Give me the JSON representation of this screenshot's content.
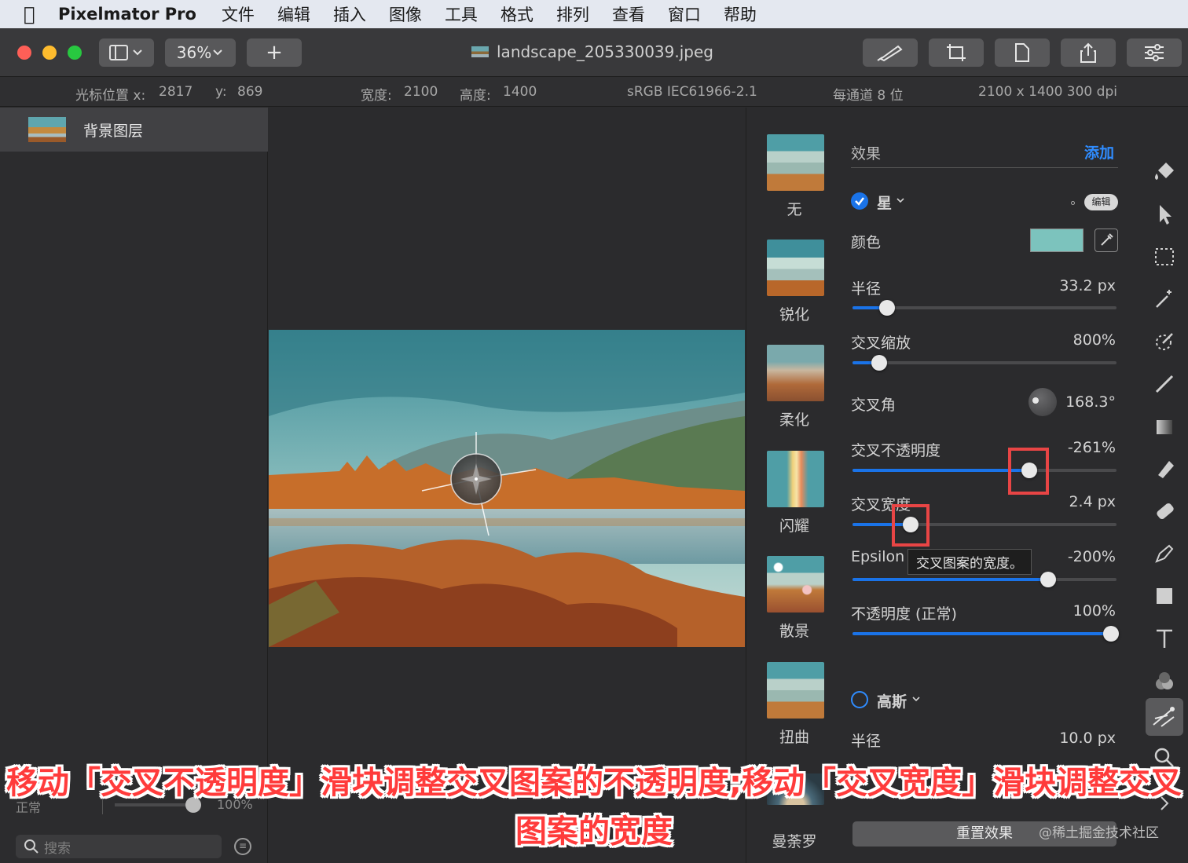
{
  "menubar": {
    "app_name": "Pixelmator Pro",
    "items": [
      "文件",
      "编辑",
      "插入",
      "图像",
      "工具",
      "格式",
      "排列",
      "查看",
      "窗口",
      "帮助"
    ]
  },
  "toolbar": {
    "zoom": "36%",
    "add_label": "+",
    "document_title": "landscape_205330039.jpeg"
  },
  "infobar": {
    "cursor_x_label": "光标位置 x:",
    "cursor_x": "2817",
    "cursor_y_label": "y:",
    "cursor_y": "869",
    "width_label": "宽度:",
    "width": "2100",
    "height_label": "高度:",
    "height": "1400",
    "color_profile": "sRGB IEC61966-2.1",
    "bit_depth": "每通道 8 位",
    "dimensions": "2100 x 1400 300 dpi"
  },
  "layers": {
    "items": [
      {
        "label": "背景图层"
      }
    ],
    "blend_mode": "正常",
    "opacity": "100%",
    "search_placeholder": "搜索"
  },
  "effect_categories": [
    {
      "label": "无"
    },
    {
      "label": "锐化"
    },
    {
      "label": "柔化"
    },
    {
      "label": "闪耀"
    },
    {
      "label": "散景"
    },
    {
      "label": "扭曲"
    },
    {
      "label": "曼荼罗"
    }
  ],
  "effects": {
    "header": "效果",
    "add_label": "添加",
    "star": {
      "name": "星",
      "enabled": true,
      "edit_label": "编辑",
      "color_label": "颜色",
      "color_swatch": "#7cc3bd",
      "params": [
        {
          "label": "半径",
          "value": "33.2 px",
          "fraction": 0.13
        },
        {
          "label": "交叉缩放",
          "value": "800%",
          "fraction": 0.1
        },
        {
          "label": "交叉角",
          "value": "168.3°"
        },
        {
          "label": "交叉不透明度",
          "value": "-261%",
          "fraction": 0.67
        },
        {
          "label": "交叉宽度",
          "value": "2.4 px",
          "fraction": 0.22
        },
        {
          "label": "Epsilon",
          "value": "-200%",
          "fraction": 0.74
        },
        {
          "label": "不透明度 (正常)",
          "value": "100%",
          "fraction": 0.98
        }
      ],
      "tooltip": "交叉图案的宽度。"
    },
    "gaussian": {
      "name": "高斯",
      "enabled": false,
      "param_label": "半径",
      "param_value": "10.0 px"
    },
    "reset_label": "重置效果"
  },
  "caption": {
    "line1": "移动「交叉不透明度」滑块调整交叉图案的不透明度;移动「交叉宽度」滑块调整交叉",
    "line2": "图案的宽度"
  },
  "watermark": "@稀土掘金技术社区",
  "colors": {
    "accent": "#1a73e8",
    "highlight": "#e84545",
    "caption": "#ff3b3b"
  }
}
